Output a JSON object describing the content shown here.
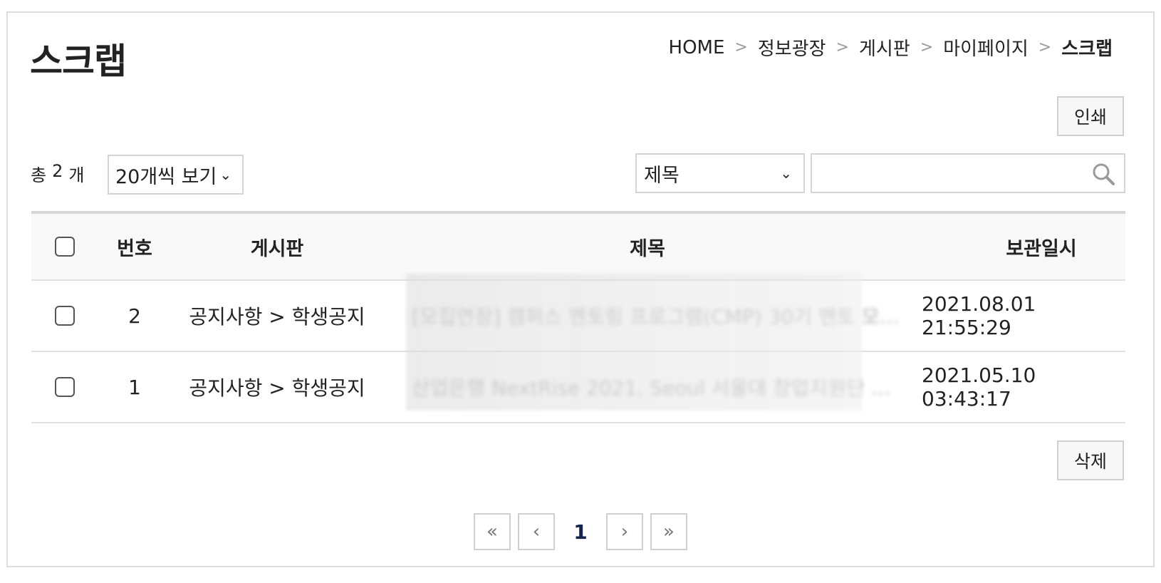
{
  "page": {
    "title": "스크랩"
  },
  "breadcrumb": {
    "items": [
      "HOME",
      "정보광장",
      "게시판",
      "마이페이지",
      "스크랩"
    ],
    "separator": ">"
  },
  "toolbar": {
    "print_label": "인쇄",
    "delete_label": "삭제"
  },
  "list_info": {
    "total_prefix": "총",
    "total_count": "2",
    "total_suffix": "개",
    "per_page_selected": "20개씩 보기"
  },
  "search": {
    "field_selected": "제목",
    "input_value": "",
    "icon": "search-icon"
  },
  "table": {
    "headers": {
      "number": "번호",
      "board": "게시판",
      "title": "제목",
      "saved_at": "보관일시"
    },
    "rows": [
      {
        "number": "2",
        "board": "공지사항 > 학생공지",
        "title": "[모집연장] 캠퍼스 멘토링 프로그램(CMP) 30기 멘토 모집 …",
        "saved_at": "2021.08.01 21:55:29"
      },
      {
        "number": "1",
        "board": "공지사항 > 학생공지",
        "title": "산업은행 NextRise 2021, Seoul 서울대 창업지원단 …",
        "saved_at": "2021.05.10 03:43:17"
      }
    ]
  },
  "pagination": {
    "first": "«",
    "prev": "‹",
    "current": "1",
    "next": "›",
    "last": "»"
  },
  "colors": {
    "border": "#dddddd",
    "header_bg": "#f8f8f8",
    "current_page": "#13244f"
  }
}
